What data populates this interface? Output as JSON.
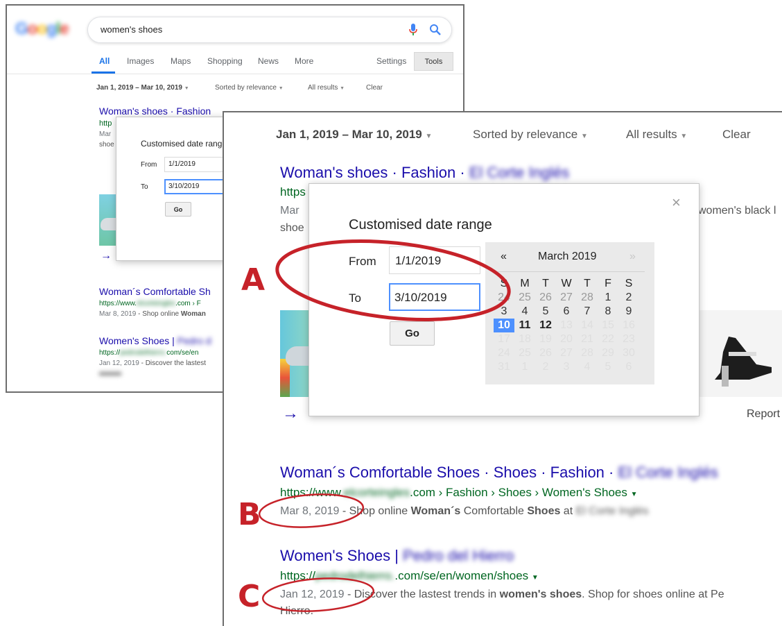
{
  "search": {
    "query": "women's shoes"
  },
  "nav": {
    "tabs": [
      "All",
      "Images",
      "Maps",
      "Shopping",
      "News",
      "More"
    ],
    "settings": "Settings",
    "tools": "Tools"
  },
  "toolbar": {
    "date_range": "Jan 1, 2019 – Mar 10, 2019",
    "sort": "Sorted by relevance",
    "results": "All results",
    "clear": "Clear"
  },
  "dialog": {
    "title": "Customised date range",
    "from_label": "From",
    "from_value": "1/1/2019",
    "to_label": "To",
    "to_value": "3/10/2019",
    "go": "Go"
  },
  "calendar": {
    "prev": "«",
    "next": "»",
    "month": "March 2019",
    "weekdays": [
      "S",
      "M",
      "T",
      "W",
      "T",
      "F",
      "S"
    ],
    "rows": [
      [
        {
          "d": "24",
          "t": "o"
        },
        {
          "d": "25",
          "t": "o"
        },
        {
          "d": "26",
          "t": "o"
        },
        {
          "d": "27",
          "t": "o"
        },
        {
          "d": "28",
          "t": "o"
        },
        {
          "d": "1",
          "t": "m"
        },
        {
          "d": "2",
          "t": "m"
        }
      ],
      [
        {
          "d": "3",
          "t": "m"
        },
        {
          "d": "4",
          "t": "m"
        },
        {
          "d": "5",
          "t": "m"
        },
        {
          "d": "6",
          "t": "m"
        },
        {
          "d": "7",
          "t": "m"
        },
        {
          "d": "8",
          "t": "m"
        },
        {
          "d": "9",
          "t": "m"
        }
      ],
      [
        {
          "d": "10",
          "t": "sel"
        },
        {
          "d": "11",
          "t": "act"
        },
        {
          "d": "12",
          "t": "act"
        },
        {
          "d": "13",
          "t": "f"
        },
        {
          "d": "14",
          "t": "f"
        },
        {
          "d": "15",
          "t": "f"
        },
        {
          "d": "16",
          "t": "f"
        }
      ],
      [
        {
          "d": "17",
          "t": "f"
        },
        {
          "d": "18",
          "t": "f"
        },
        {
          "d": "19",
          "t": "f"
        },
        {
          "d": "20",
          "t": "f"
        },
        {
          "d": "21",
          "t": "f"
        },
        {
          "d": "22",
          "t": "f"
        },
        {
          "d": "23",
          "t": "f"
        }
      ],
      [
        {
          "d": "24",
          "t": "f"
        },
        {
          "d": "25",
          "t": "f"
        },
        {
          "d": "26",
          "t": "f"
        },
        {
          "d": "27",
          "t": "f"
        },
        {
          "d": "28",
          "t": "f"
        },
        {
          "d": "29",
          "t": "f"
        },
        {
          "d": "30",
          "t": "f"
        }
      ],
      [
        {
          "d": "31",
          "t": "f"
        },
        {
          "d": "1",
          "t": "f"
        },
        {
          "d": "2",
          "t": "f"
        },
        {
          "d": "3",
          "t": "f"
        },
        {
          "d": "4",
          "t": "f"
        },
        {
          "d": "5",
          "t": "f"
        },
        {
          "d": "6",
          "t": "f"
        }
      ]
    ]
  },
  "results": {
    "r1": {
      "title": "Woman's shoes · Fashion ·",
      "title_short": "Woman's shoes · Fashion",
      "url_start": "https",
      "url_start_short": "http",
      "snippet_date": "Mar",
      "snippet_line2": "shoe",
      "snippet_line2_short": "shoe",
      "snippet_tail": "women's black l",
      "report": "Report"
    },
    "r2": {
      "title": "Woman´s Comfortable Shoes · Shoes · Fashion ·",
      "title_short": "Woman´s Comfortable Sh",
      "url_prefix": "https://www.",
      "url_suffix": ".com › Fashion › Shoes › Women's Shoes",
      "url_suffix_short": ".com › F",
      "date": "Mar 8, 2019",
      "snippet_prefix": " - Shop online ",
      "snippet_bold1": "Woman´s",
      "snippet_mid": " Comfortable ",
      "snippet_bold2": "Shoes",
      "snippet_end": " at",
      "snippet_short_end": "Woman"
    },
    "r3": {
      "title": "Women's Shoes |",
      "title_short": "Women's Shoes |",
      "url_prefix": "https://",
      "url_suffix": ".com/se/en/women/shoes",
      "url_suffix_short": "com/se/en",
      "date": "Jan 12, 2019",
      "snippet_prefix": " - Discover the lastest trends in ",
      "snippet_bold": "women's shoes",
      "snippet_end": ". Shop for shoes online at Pe",
      "snippet_short": " - Discover the lastest",
      "snippet_line2": "Hierro."
    }
  },
  "annotations": {
    "a": "A",
    "b": "B",
    "c": "C",
    "color": "#c62229"
  }
}
